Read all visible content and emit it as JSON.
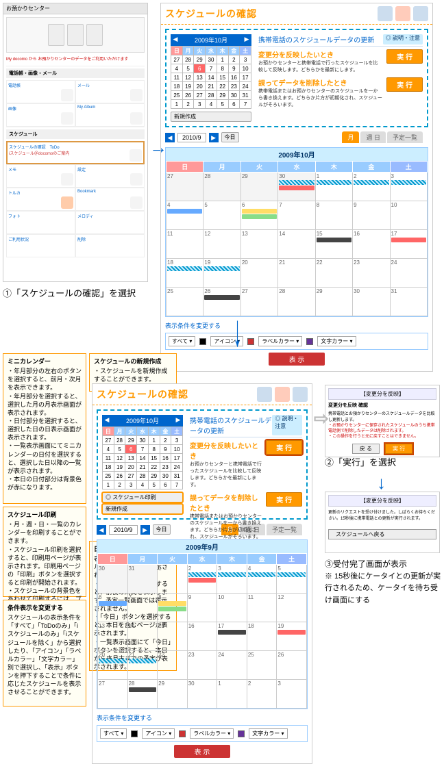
{
  "omakase": {
    "header": "お預かりセンター",
    "red": "My docomo から お預かりセンターのデータをご利用いただけます"
  },
  "step1_caption": "①「スケジュールの確認」を選択",
  "schedule": {
    "title": "スケジュールの確認",
    "sync_title": "携帯電話のスケジュールデータの更新",
    "help": "◎ 説明・注意",
    "reflect_label": "変更分を反映したいとき",
    "reflect_desc": "お預かりセンターと携帯電話で行ったスケジュールを比較して反映します。どちらかを最新にします。",
    "delete_label": "誤ってデータを削除したとき",
    "delete_desc": "携帯電話またはお預かりセンターのスケジュールを一から書き換えます。どちらか片方が初期化され、スケジュールがそろいます。",
    "exec": "実 行",
    "new_btn": "新規作成",
    "print_btn": "◎ スケジュール印刷",
    "today_btn": "今日",
    "tabs": {
      "month": "月",
      "weekday": "週 日",
      "todo": "予定一覧"
    },
    "month_header_top": "2009年10月",
    "month_header_bottom": "2009年9月",
    "date_label_top": "2010/9",
    "days": [
      "日",
      "月",
      "火",
      "水",
      "木",
      "金",
      "土"
    ],
    "mini_cal_month": "2009年10月",
    "mini_cal_rows": [
      [
        "27",
        "28",
        "29",
        "30",
        "1",
        "2",
        "3"
      ],
      [
        "4",
        "5",
        "6",
        "7",
        "8",
        "9",
        "10"
      ],
      [
        "11",
        "12",
        "13",
        "14",
        "15",
        "16",
        "17"
      ],
      [
        "18",
        "19",
        "20",
        "21",
        "22",
        "23",
        "24"
      ],
      [
        "25",
        "26",
        "27",
        "28",
        "29",
        "30",
        "31"
      ],
      [
        "1",
        "2",
        "3",
        "4",
        "5",
        "6",
        "7"
      ]
    ],
    "big_cal_top": [
      [
        "27",
        "28",
        "29",
        "30",
        "1",
        "2",
        "3"
      ],
      [
        "4",
        "5",
        "6",
        "7",
        "8",
        "9",
        "10"
      ],
      [
        "11",
        "12",
        "13",
        "14",
        "15",
        "16",
        "17"
      ],
      [
        "18",
        "19",
        "20",
        "21",
        "22",
        "23",
        "24"
      ],
      [
        "25",
        "26",
        "27",
        "28",
        "29",
        "30",
        "31"
      ]
    ],
    "big_cal_bottom": [
      [
        "30",
        "31",
        "1",
        "2",
        "3",
        "4",
        "5"
      ],
      [
        "6",
        "7",
        "8",
        "9",
        "10",
        "11",
        "12"
      ],
      [
        "13",
        "14",
        "15",
        "16",
        "17",
        "18",
        "19"
      ],
      [
        "20",
        "21",
        "22",
        "23",
        "24",
        "25",
        "26"
      ],
      [
        "27",
        "28",
        "29",
        "30",
        "1",
        "2",
        "3"
      ]
    ],
    "filter_title": "表示条件を変更する",
    "filter_all": "すべて",
    "filter_icon": "アイコン",
    "filter_label": "ラベルカラー",
    "filter_text": "文字カラー",
    "show_btn": "表 示"
  },
  "ann": {
    "mini_h": "ミニカレンダー",
    "mini_b": "・年月部分の左右のボタンを選択すると、前月・次月を表示できます。\n・年月部分を選択すると、選択した月の月表示画面が表示されます。\n・日付部分を選択すると、選択した日の日表示画面が表示されます。\n・一覧表示画面にてミニカレンダーの日付を選択すると、選択した日以降の一覧が表示されます。\n・本日の日付部分は背景色が赤になります。",
    "print_h": "スケジュール印刷",
    "print_b": "・月・週・日・一覧のカレンダーを印刷することができます。\n・スケジュール印刷を選択すると、印刷用ページが表示されます。印刷用ページの「印刷」ボタンを選択すると印刷が開始されます。\n・スケジュールの背景色をあわせて印刷するには、ブラウザの設定を変更する必要があります。",
    "cond_h": "条件表示を変更する",
    "cond_b": "スケジュールの表示条件を「すべて」「ToDoのみ」「iスケジュールのみ」「iスケジュールを除く」から選択したり、「アイコン」「ラベルカラー」「文字カラー」別で選択し、「表示」ボタンを押下することで条件に応じたスケジュールを表示させることができます。",
    "new_h": "スケジュールの新規作成",
    "new_b": "・スケジュールを新規作成することができます。\n・iスケジュールは新規作成することができません。",
    "date_h": "日付表示",
    "date_b": "表示されているスケジュールの年月日や期間が表示されます。\n・左右のボタンを選択すると、前後の期間を表示します。予定一覧画面では表示されません。\n・「今日」ボタンを選択すると、本日を含むページが表示されます。\n・一覧表示画面にて「今日」ボタンを選択すると、本日から来月末までの予定が表示されます。"
  },
  "confirm": {
    "titlebar": "【変更分を反映】",
    "head": "変更分を反映 確認",
    "desc": "携帯電話とお預かりセンターのスケジュールデータを比較し更新します。",
    "red": "・お預かりセンターに保存されたスケジュールのうち携帯電話側で削除したデータは削除されます。\n・この操作を行うと元に戻すことはできません。",
    "back": "戻 る",
    "exec": "実 行"
  },
  "step2_caption": "②「実行」を選択",
  "done": {
    "titlebar": "【変更分を反映】",
    "msg": "更新のリクエストを受け付けました。しばらくお待ちください。15秒後に携帯電話との更新が実行されます。",
    "back": "スケジュールへ戻る"
  },
  "step3_caption": "③受付完了画面が表示",
  "step3_note": "※ 15秒後にケータイとの更新が実行されるため、ケータイを待ち受け画面にする"
}
